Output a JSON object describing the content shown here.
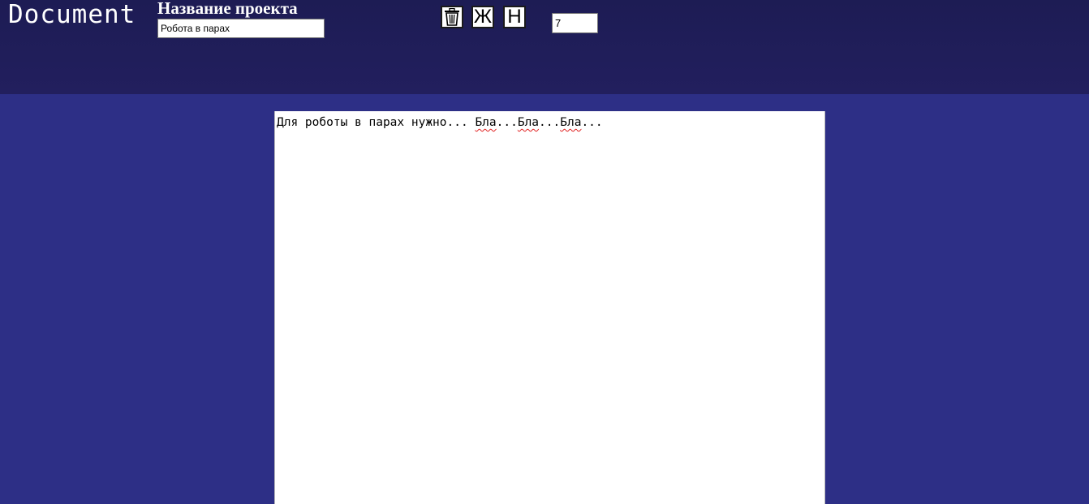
{
  "header": {
    "app_title": "Document",
    "project_label": "Название проекта",
    "project_name": "Робота в парах"
  },
  "toolbar": {
    "delete_icon": "trash-icon",
    "bold_label": "Ж",
    "normal_label": "Н",
    "font_size": "7"
  },
  "editor": {
    "text_prefix": "Для роботы в парах нужно... ",
    "word1": "Бла",
    "sep1": "...",
    "word2": "Бла",
    "sep2": "...",
    "word3": "Бла",
    "sep3": "..."
  },
  "colors": {
    "header_bg": "#1f1e5a",
    "page_bg": "#2d2f86",
    "editor_bg": "#ffffff"
  }
}
